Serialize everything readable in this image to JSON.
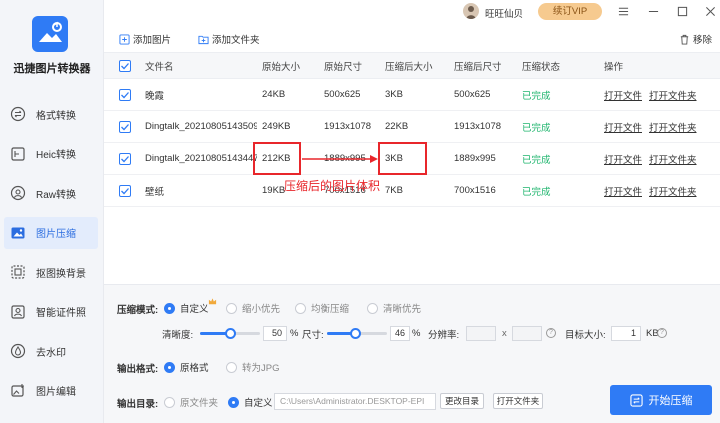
{
  "app": {
    "name": "迅捷图片转换器"
  },
  "sidebar": {
    "items": [
      {
        "label": "格式转换",
        "icon": "swap-icon"
      },
      {
        "label": "Heic转换",
        "icon": "heic-icon"
      },
      {
        "label": "Raw转换",
        "icon": "raw-icon"
      },
      {
        "label": "图片压缩",
        "icon": "image-compress-icon",
        "active": true
      },
      {
        "label": "抠图换背景",
        "icon": "cutout-icon"
      },
      {
        "label": "智能证件照",
        "icon": "id-photo-icon"
      },
      {
        "label": "去水印",
        "icon": "watermark-icon"
      },
      {
        "label": "图片编辑",
        "icon": "image-edit-icon"
      }
    ]
  },
  "topbar": {
    "user_name": "旺旺仙贝",
    "vip_label": "续订VIP"
  },
  "toolbar": {
    "add_image": "添加图片",
    "add_folder": "添加文件夹",
    "remove": "移除"
  },
  "table": {
    "headers": [
      "文件名",
      "原始大小",
      "原始尺寸",
      "压缩后大小",
      "压缩后尺寸",
      "压缩状态",
      "操作"
    ],
    "rows": [
      {
        "name": "晚霞",
        "orig_size": "24KB",
        "orig_dim": "500x625",
        "new_size": "3KB",
        "new_dim": "500x625",
        "status": "已完成",
        "op1": "打开文件",
        "op2": "打开文件夹"
      },
      {
        "name": "Dingtalk_20210805143509",
        "orig_size": "249KB",
        "orig_dim": "1913x1078",
        "new_size": "22KB",
        "new_dim": "1913x1078",
        "status": "已完成",
        "op1": "打开文件",
        "op2": "打开文件夹"
      },
      {
        "name": "Dingtalk_20210805143447",
        "orig_size": "212KB",
        "orig_dim": "1889x995",
        "new_size": "3KB",
        "new_dim": "1889x995",
        "status": "已完成",
        "op1": "打开文件",
        "op2": "打开文件夹"
      },
      {
        "name": "壁纸",
        "orig_size": "19KB",
        "orig_dim": "700x1516",
        "new_size": "7KB",
        "new_dim": "700x1516",
        "status": "已完成",
        "op1": "打开文件",
        "op2": "打开文件夹"
      }
    ]
  },
  "annotation": {
    "text": "压缩后的图片体积",
    "color": "#e8262b"
  },
  "settings": {
    "mode_label": "压缩模式:",
    "modes": [
      {
        "label": "自定义",
        "selected": true
      },
      {
        "label": "缩小优先",
        "selected": false
      },
      {
        "label": "均衡压缩",
        "selected": false
      },
      {
        "label": "清晰优先",
        "selected": false
      }
    ],
    "clarity_label": "清晰度:",
    "clarity_value": "50",
    "clarity_pct": 50,
    "size_label": "尺寸:",
    "size_value": "46",
    "size_pct": 46,
    "percent_unit": "%",
    "resolution_label": "分辨率:",
    "resolution_x_sep": "x",
    "target_label": "目标大小:",
    "target_value": "1",
    "target_unit": "KB",
    "output_format_label": "输出格式:",
    "formats": [
      {
        "label": "原格式",
        "selected": true
      },
      {
        "label": "转为JPG",
        "selected": false
      }
    ],
    "output_dir_label": "输出目录:",
    "dirs": [
      {
        "label": "原文件夹",
        "selected": false
      },
      {
        "label": "自定义",
        "selected": true
      }
    ],
    "path_value": "C:\\Users\\Administrator.DESKTOP-EPI",
    "change_dir": "更改目录",
    "open_folder": "打开文件夹",
    "start": "开始压缩"
  },
  "colors": {
    "accent": "#2f7bf5",
    "success": "#1fb56e",
    "vip": "#f6ca8f",
    "annotation": "#e8262b"
  }
}
